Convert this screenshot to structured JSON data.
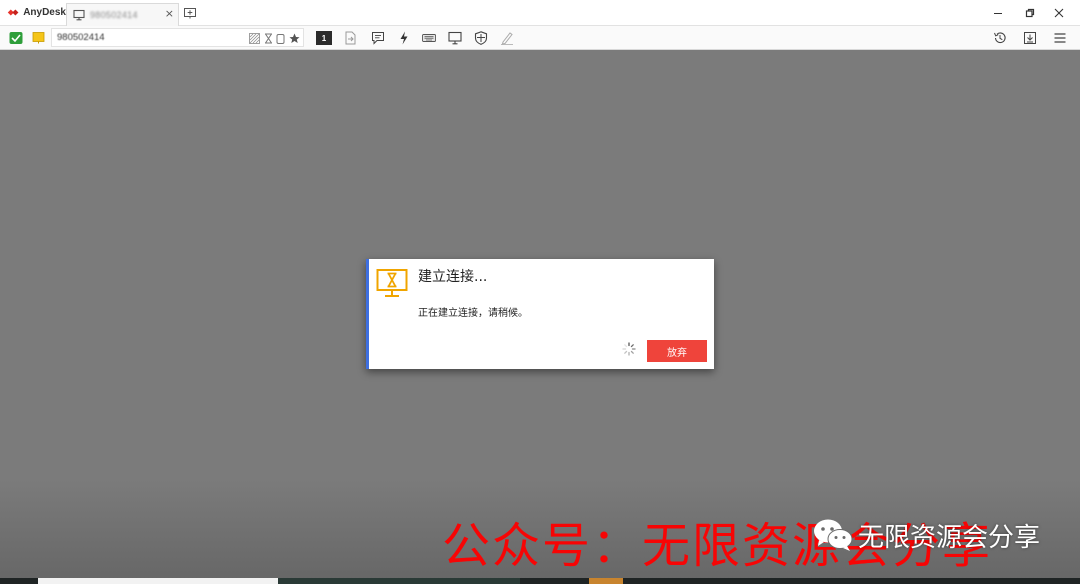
{
  "app": {
    "name": "AnyDesk",
    "brand_color": "#e8342c"
  },
  "tab": {
    "title": "980502414",
    "close_label": "×"
  },
  "address_bar": {
    "value": "980502414"
  },
  "toolbar": {
    "monitor_number": "1",
    "icons": [
      "file-transfer-icon",
      "chat-icon",
      "actions-lightning-icon",
      "keyboard-icon",
      "display-icon",
      "permissions-shield-icon",
      "whiteboard-pen-icon"
    ],
    "right_icons": [
      "history-icon",
      "download-icon",
      "menu-icon"
    ]
  },
  "dialog": {
    "title": "建立连接...",
    "message": "正在建立连接，请稍候。",
    "abort_label": "放弃",
    "accent_color": "#3e6fe0",
    "button_color": "#ef443b",
    "icon_color": "#f0a500"
  },
  "watermark": {
    "red_text": "公众号：无限资源会分享",
    "white_text": "无限资源会分享"
  }
}
